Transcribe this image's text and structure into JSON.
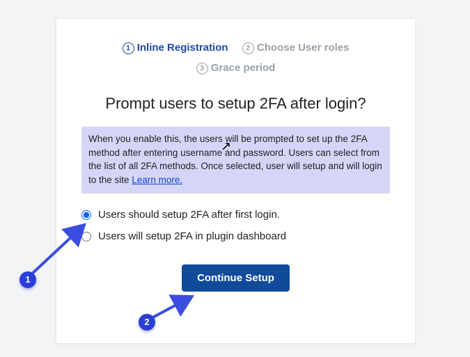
{
  "steps": {
    "s1": "Inline Registration",
    "s2": "Choose User roles",
    "s3": "Grace period",
    "n1": "1",
    "n2": "2",
    "n3": "3"
  },
  "title": "Prompt users to setup 2FA after login?",
  "info_text": "When you enable this, the users will be prompted to set up the 2FA method after entering username and password. Users can select from the list of all 2FA methods. Once selected, user will setup and will login to the site ",
  "learn_more": "Learn more.",
  "opt1": "Users should setup 2FA after first login.",
  "opt2": "Users will setup 2FA in plugin dashboard",
  "continue": "Continue Setup",
  "badge1": "1",
  "badge2": "2"
}
